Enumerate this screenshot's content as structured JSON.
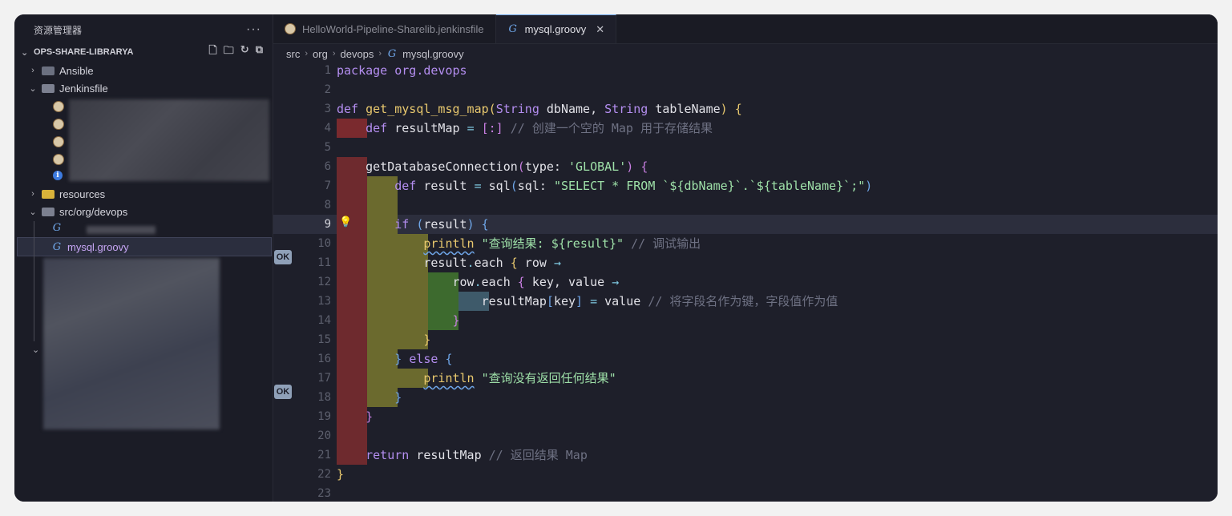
{
  "explorer": {
    "title": "资源管理器",
    "more": "···",
    "project": "OPS-SHARE-LIBRARYA",
    "items": [
      {
        "label": "Ansible"
      },
      {
        "label": "Jenkinsfile"
      },
      {
        "label": "resources"
      },
      {
        "label": "src/org/devops"
      },
      {
        "label": "mysql.groovy"
      }
    ]
  },
  "tabs": [
    {
      "label": "HelloWorld-Pipeline-Sharelib.jenkinsfile"
    },
    {
      "label": "mysql.groovy"
    }
  ],
  "breadcrumb": [
    "src",
    "org",
    "devops",
    "mysql.groovy"
  ],
  "code": {
    "line_numbers": [
      "1",
      "2",
      "3",
      "4",
      "5",
      "6",
      "7",
      "8",
      "9",
      "10",
      "11",
      "12",
      "13",
      "14",
      "15",
      "16",
      "17",
      "18",
      "19",
      "20",
      "21",
      "22",
      "23"
    ],
    "current_line": "9",
    "ok_badge": "OK"
  },
  "colors": {
    "background": "#1e1f2a",
    "rainbow_red": "#7a2a2e",
    "rainbow_olive": "#6b6a2e",
    "rainbow_green": "#3d6a2e",
    "rainbow_teal": "#3e5a6a"
  }
}
